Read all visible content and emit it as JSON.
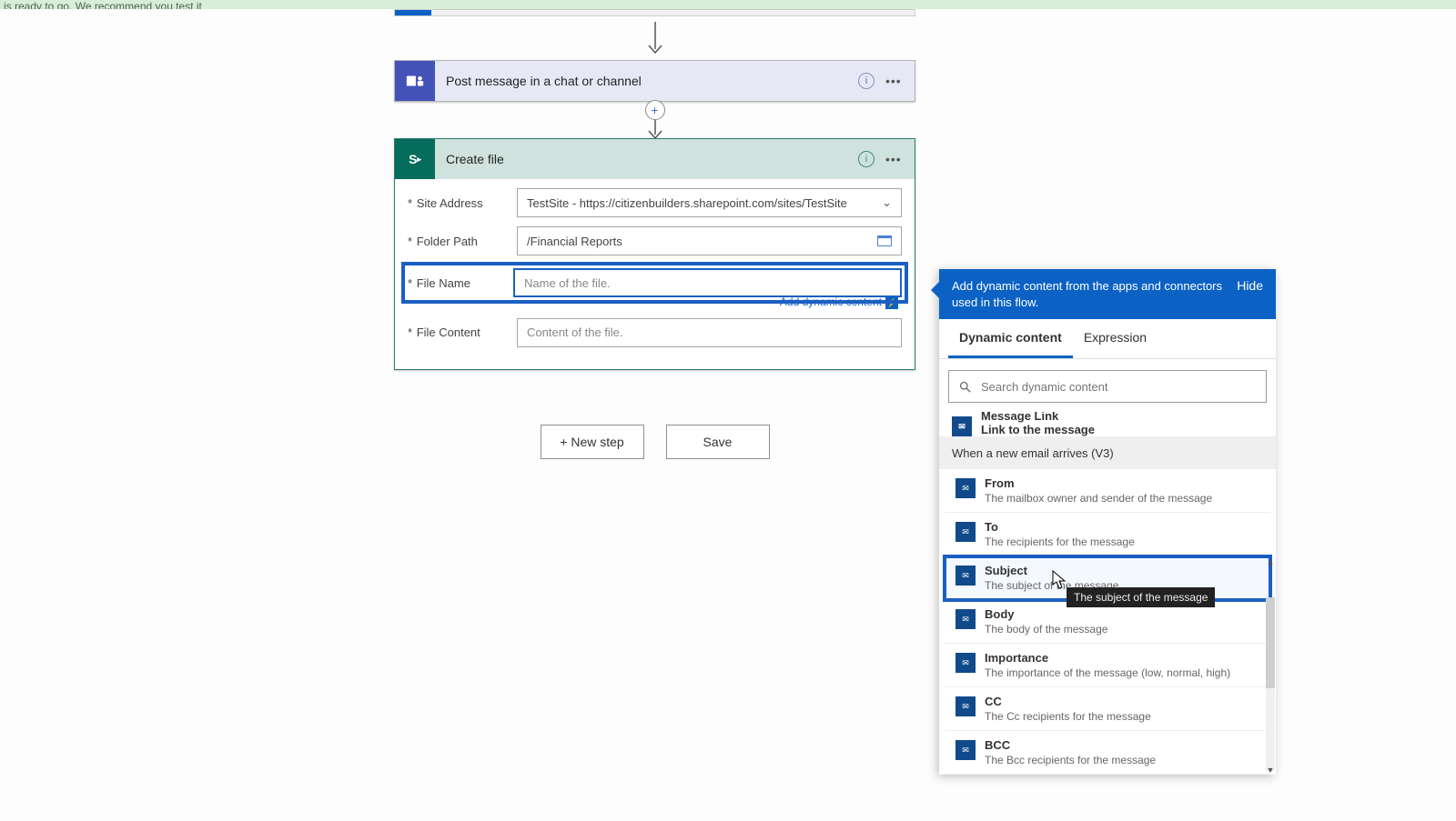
{
  "banner_text": "is ready to go. We recommend you test it",
  "teams_action_title": "Post message in a chat or channel",
  "sp_action_title": "Create file",
  "form": {
    "site_label": "Site Address",
    "site_value": "TestSite - https://citizenbuilders.sharepoint.com/sites/TestSite",
    "folder_label": "Folder Path",
    "folder_value": "/Financial Reports",
    "filename_label": "File Name",
    "filename_placeholder": "Name of the file.",
    "filecontent_label": "File Content",
    "filecontent_placeholder": "Content of the file.",
    "add_dynamic_label": "Add dynamic content"
  },
  "buttons": {
    "new_step": "+ New step",
    "save": "Save"
  },
  "dyn": {
    "header_text": "Add dynamic content from the apps and connectors used in this flow.",
    "hide": "Hide",
    "tab_dynamic": "Dynamic content",
    "tab_expression": "Expression",
    "search_placeholder": "Search dynamic content",
    "partial_item": {
      "name": "Message Link",
      "desc": "Link to the message"
    },
    "section": "When a new email arrives (V3)",
    "items": [
      {
        "name": "From",
        "desc": "The mailbox owner and sender of the message"
      },
      {
        "name": "To",
        "desc": "The recipients for the message"
      },
      {
        "name": "Subject",
        "desc": "The subject of the message"
      },
      {
        "name": "Body",
        "desc": "The body of the message"
      },
      {
        "name": "Importance",
        "desc": "The importance of the message (low, normal, high)"
      },
      {
        "name": "CC",
        "desc": "The Cc recipients for the message"
      },
      {
        "name": "BCC",
        "desc": "The Bcc recipients for the message"
      }
    ],
    "highlight_index": 2,
    "tooltip": "The subject of the message"
  }
}
